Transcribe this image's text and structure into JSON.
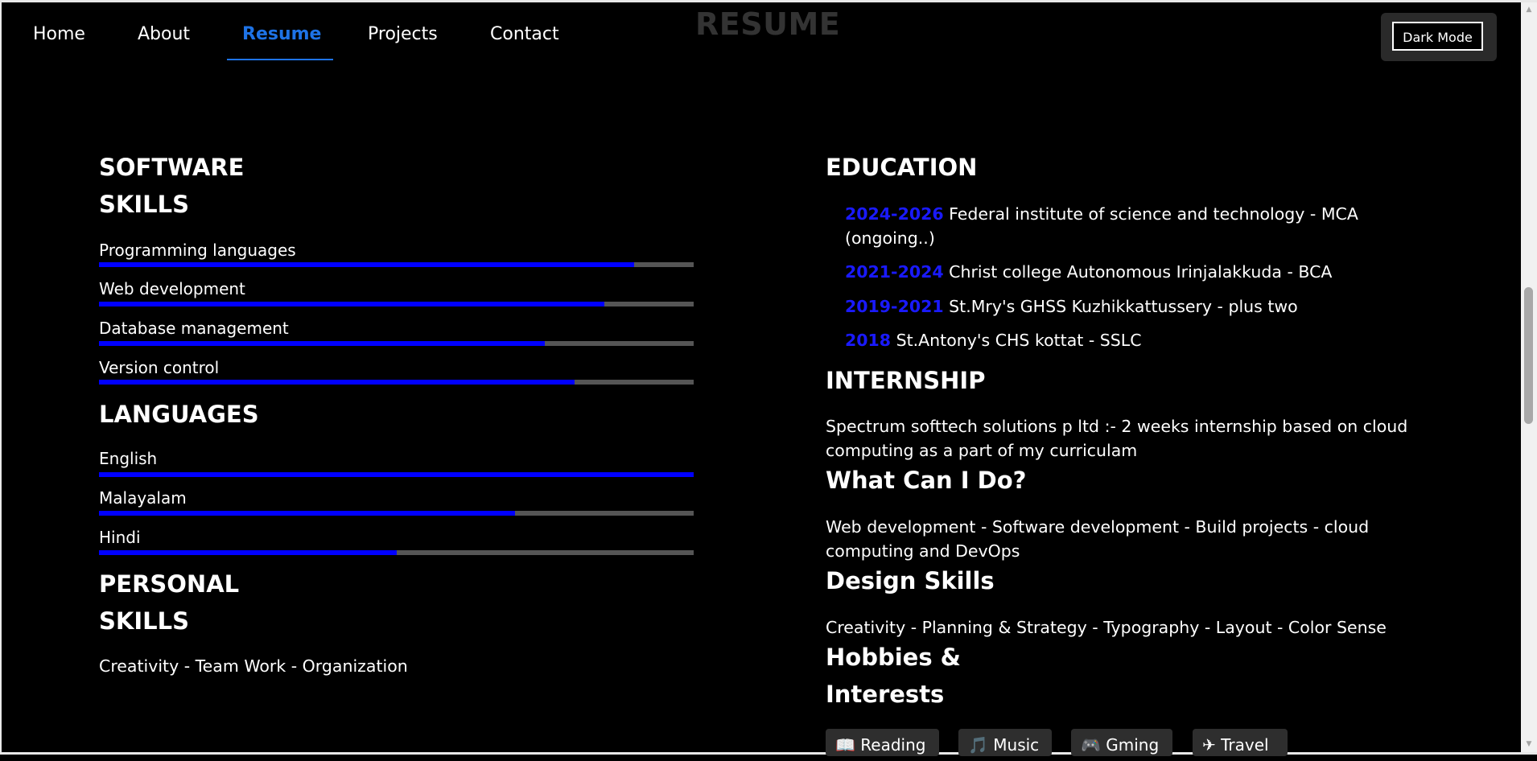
{
  "nav": {
    "items": [
      {
        "label": "Home"
      },
      {
        "label": "About"
      },
      {
        "label": "Resume"
      },
      {
        "label": "Projects"
      },
      {
        "label": "Contact"
      }
    ],
    "active": "Resume"
  },
  "page_title": "RESUME",
  "mode_button": "Dark Mode",
  "software_skills": {
    "heading_line1": "SOFTWARE",
    "heading_line2": "SKILLS",
    "items": [
      {
        "label": "Programming languages",
        "level": 0.9
      },
      {
        "label": "Web development",
        "level": 0.85
      },
      {
        "label": "Database management",
        "level": 0.75
      },
      {
        "label": "Version control",
        "level": 0.8
      }
    ]
  },
  "languages": {
    "heading": "LANGUAGES",
    "items": [
      {
        "label": "English",
        "level": 1.0
      },
      {
        "label": "Malayalam",
        "level": 0.7
      },
      {
        "label": "Hindi",
        "level": 0.5
      }
    ]
  },
  "personal_skills": {
    "heading_line1": "PERSONAL",
    "heading_line2": "SKILLS",
    "text": "Creativity - Team Work - Organization"
  },
  "education": {
    "heading": "EDUCATION",
    "items": [
      {
        "years": "2024-2026",
        "text": " Federal institute of science and technology - MCA",
        "text2": "(ongoing..)"
      },
      {
        "years": "2021-2024",
        "text": " Christ college Autonomous Irinjalakkuda - BCA"
      },
      {
        "years": "2019-2021",
        "text": " St.Mry's GHSS Kuzhikkattussery - plus two"
      },
      {
        "years": "2018",
        "text": " St.Antony's CHS kottat - SSLC"
      }
    ]
  },
  "internship": {
    "heading": "INTERNSHIP",
    "line1": "Spectrum softtech solutions p ltd :- 2 weeks internship based on cloud",
    "line2": "computing as a part of my curriculam"
  },
  "what_can_i_do": {
    "heading": "What Can I Do?",
    "line1": "Web development - Software development - Build projects - cloud",
    "line2": "computing and DevOps"
  },
  "design_skills": {
    "heading": "Design Skills",
    "text": "Creativity - Planning & Strategy - Typography - Layout - Color Sense"
  },
  "hobbies": {
    "heading_line1": "Hobbies &",
    "heading_line2": "Interests",
    "items": [
      {
        "icon": "book-icon",
        "label": "Reading"
      },
      {
        "icon": "music-note-icon",
        "label": "Music"
      },
      {
        "icon": "gamepad-icon",
        "label": "Gming"
      },
      {
        "icon": "airplane-icon",
        "label": "Travel"
      }
    ]
  },
  "colors": {
    "background": "#000000",
    "accent_blue": "#1e73e6",
    "bar_fill": "#0000ff",
    "bar_track": "#555555"
  }
}
